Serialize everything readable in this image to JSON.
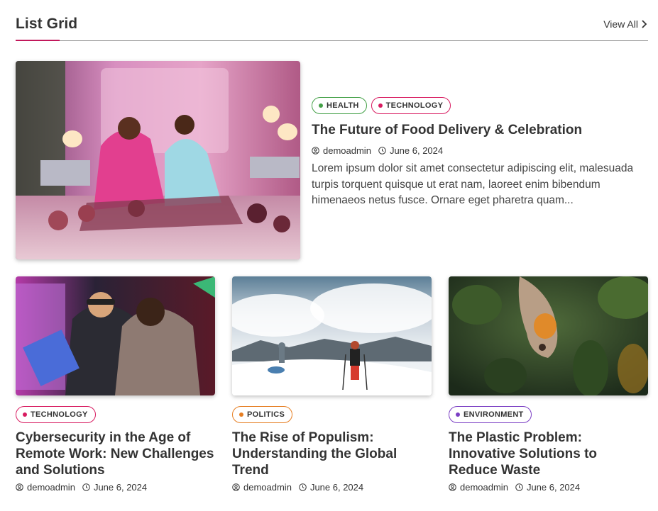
{
  "section": {
    "title": "List Grid",
    "view_all": "View All"
  },
  "colors": {
    "accent": "#c2185b",
    "health": "#43a047",
    "technology": "#d81b60",
    "politics": "#e67e22",
    "environment": "#7b3fc4"
  },
  "featured": {
    "tags": [
      "HEALTH",
      "TECHNOLOGY"
    ],
    "title": "The Future of Food Delivery & Celebration",
    "author": "demoadmin",
    "date": "June 6, 2024",
    "excerpt": "Lorem ipsum dolor sit amet consectetur adipiscing elit, malesuada turpis torquent quisque ut erat nam, laoreet enim bibendum himenaeos netus fusce. Ornare eget pharetra quam..."
  },
  "posts": [
    {
      "tag": "TECHNOLOGY",
      "title": "Cybersecurity in the Age of Remote Work: New Challenges and Solutions",
      "author": "demoadmin",
      "date": "June 6, 2024"
    },
    {
      "tag": "POLITICS",
      "title": "The Rise of Populism: Understanding the Global Trend",
      "author": "demoadmin",
      "date": "June 6, 2024"
    },
    {
      "tag": "ENVIRONMENT",
      "title": "The Plastic Problem: Innovative Solutions to Reduce Waste",
      "author": "demoadmin",
      "date": "June 6, 2024"
    }
  ],
  "icons": {
    "author": "user-circle-icon",
    "date": "clock-icon",
    "view_all": "chevron-right-icon"
  }
}
